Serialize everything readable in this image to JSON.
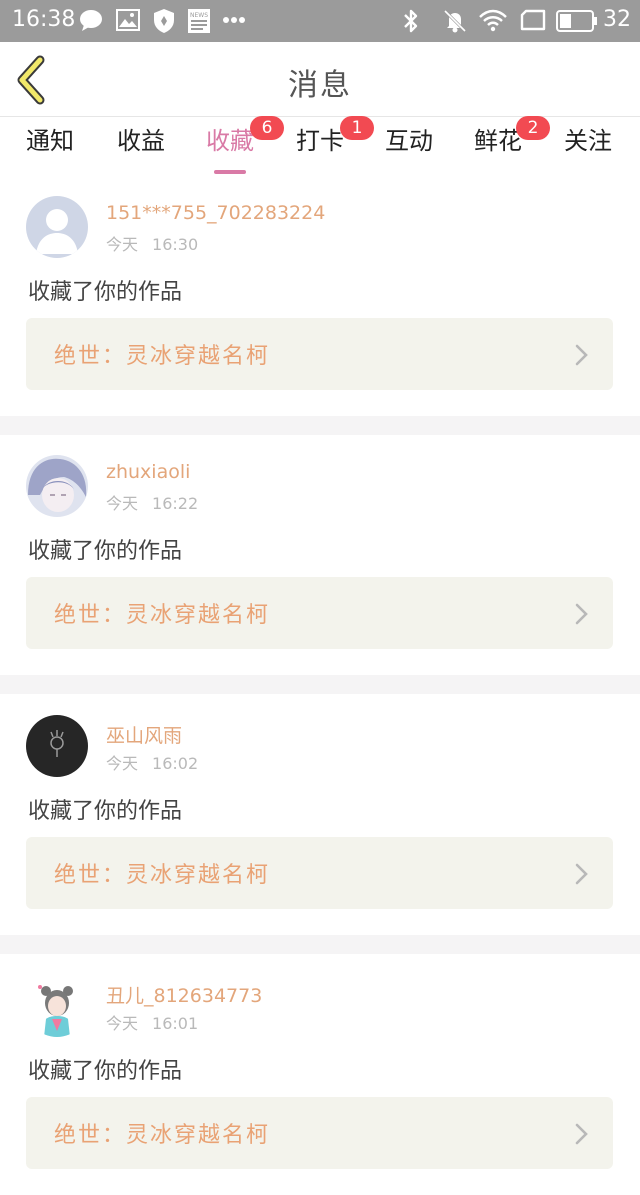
{
  "status_bar": {
    "time": "16:38",
    "battery": "32",
    "icons": [
      "message-icon",
      "image-icon",
      "shield-icon",
      "news-icon",
      "more-dots-icon",
      "bluetooth-icon",
      "mute-icon",
      "wifi-icon",
      "screen-icon",
      "battery-icon"
    ],
    "news_label": "NEWS"
  },
  "header": {
    "title": "消息",
    "back_icon": "back-chevron-icon"
  },
  "colors": {
    "accent": "#d97aa6",
    "badge": "#f24a52",
    "username": "#e3a67b",
    "work_title": "#e9a274"
  },
  "tabs": [
    {
      "label": "通知",
      "badge": ""
    },
    {
      "label": "收益",
      "badge": ""
    },
    {
      "label": "收藏",
      "badge": "6",
      "active": true
    },
    {
      "label": "打卡",
      "badge": "1"
    },
    {
      "label": "互动",
      "badge": ""
    },
    {
      "label": "鲜花",
      "badge": "2"
    },
    {
      "label": "关注",
      "badge": ""
    }
  ],
  "messages": [
    {
      "username": "151***755_702283224",
      "day": "今天",
      "time": "16:30",
      "action": "收藏了你的作品",
      "work": "绝世：灵冰穿越名柯"
    },
    {
      "username": "zhuxiaoli",
      "day": "今天",
      "time": "16:22",
      "action": "收藏了你的作品",
      "work": "绝世：灵冰穿越名柯"
    },
    {
      "username": "巫山风雨",
      "day": "今天",
      "time": "16:02",
      "action": "收藏了你的作品",
      "work": "绝世：灵冰穿越名柯"
    },
    {
      "username": "丑儿_812634773",
      "day": "今天",
      "time": "16:01",
      "action": "收藏了你的作品",
      "work": "绝世：灵冰穿越名柯"
    }
  ]
}
